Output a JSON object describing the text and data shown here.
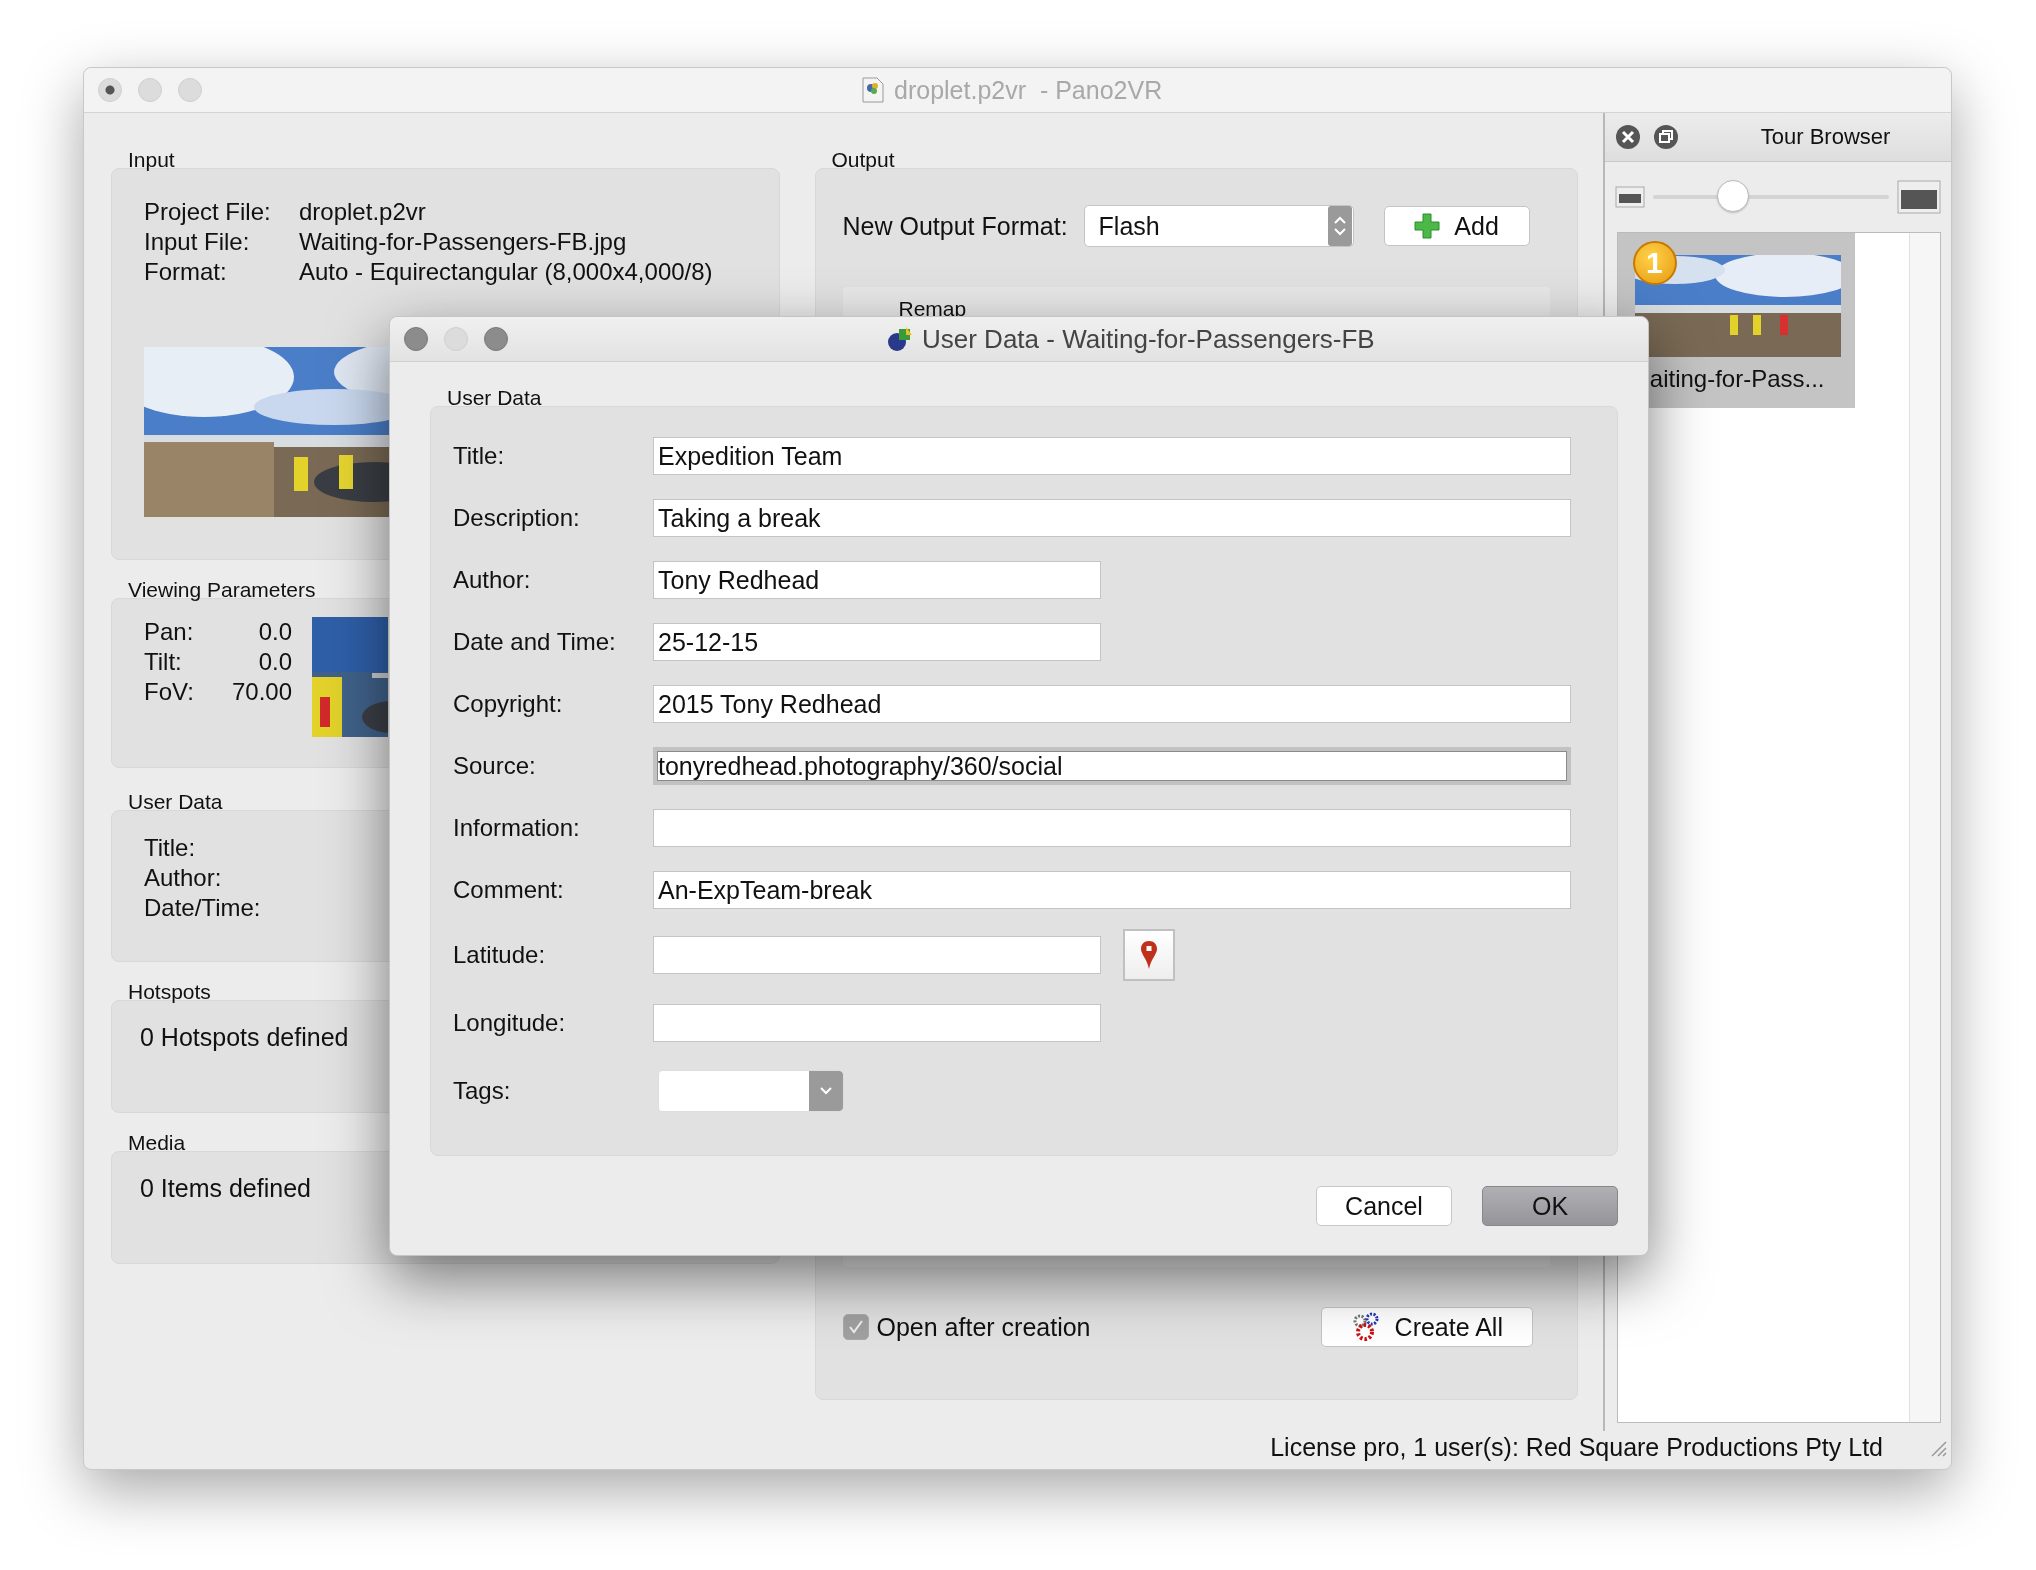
{
  "window": {
    "title": "droplet.p2vr  - Pano2VR"
  },
  "input": {
    "label": "Input",
    "rows": [
      {
        "label": "Project File:",
        "value": "droplet.p2vr"
      },
      {
        "label": "Input File:",
        "value": "Waiting-for-Passengers-FB.jpg"
      },
      {
        "label": "Format:",
        "value": "Auto - Equirectangular (8,000x4,000/8)"
      }
    ]
  },
  "viewing": {
    "label": "Viewing Parameters",
    "rows": [
      {
        "label": "Pan:",
        "value": "0.0"
      },
      {
        "label": "Tilt:",
        "value": "0.0"
      },
      {
        "label": "FoV:",
        "value": "70.00"
      }
    ]
  },
  "user_data": {
    "label": "User Data",
    "rows": [
      "Title:",
      "Author:",
      "Date/Time:"
    ]
  },
  "hotspots": {
    "label": "Hotspots",
    "text": "0 Hotspots defined"
  },
  "media": {
    "label": "Media",
    "text": "0 Items defined"
  },
  "output": {
    "label": "Output",
    "format_label": "New Output Format:",
    "format": "Flash",
    "add_button": "Add",
    "remap_label": "Remap",
    "open_after": {
      "label": "Open after creation",
      "checked": true
    },
    "create_button": "Create All"
  },
  "tour_browser": {
    "title": "Tour Browser",
    "level": 0.34,
    "items": [
      {
        "badge": "1",
        "label": "aiting-for-Pass...",
        "selected": true
      }
    ]
  },
  "license": "License pro, 1 user(s): Red Square Productions Pty Ltd",
  "dialog": {
    "title": "User Data - Waiting-for-Passengers-FB",
    "group": "User Data",
    "fields": [
      {
        "label": "Title:",
        "value": "Expedition Team",
        "kind": "wide",
        "focused": false
      },
      {
        "label": "Description:",
        "value": "Taking a break",
        "kind": "wide",
        "focused": false
      },
      {
        "label": "Author:",
        "value": "Tony Redhead",
        "kind": "short",
        "focused": false
      },
      {
        "label": "Date and Time:",
        "value": "25-12-15",
        "kind": "short",
        "focused": false
      },
      {
        "label": "Copyright:",
        "value": "2015 Tony Redhead",
        "kind": "wide",
        "focused": false
      },
      {
        "label": "Source:",
        "value": "tonyredhead.photography/360/social",
        "kind": "wide",
        "focused": true
      },
      {
        "label": "Information:",
        "kind": "wide",
        "focused": false
      },
      {
        "label": "Comment:",
        "value": "An-ExpTeam-break",
        "kind": "wide",
        "focused": false
      },
      {
        "label": "Latitude:",
        "kind": "location",
        "focused": false
      },
      {
        "label": "Longitude:",
        "kind": "short",
        "focused": false
      },
      {
        "label": "Tags:",
        "kind": "combo",
        "focused": false
      }
    ],
    "buttons": [
      {
        "label": "Cancel",
        "default": false
      },
      {
        "label": "OK",
        "default": true
      }
    ]
  }
}
